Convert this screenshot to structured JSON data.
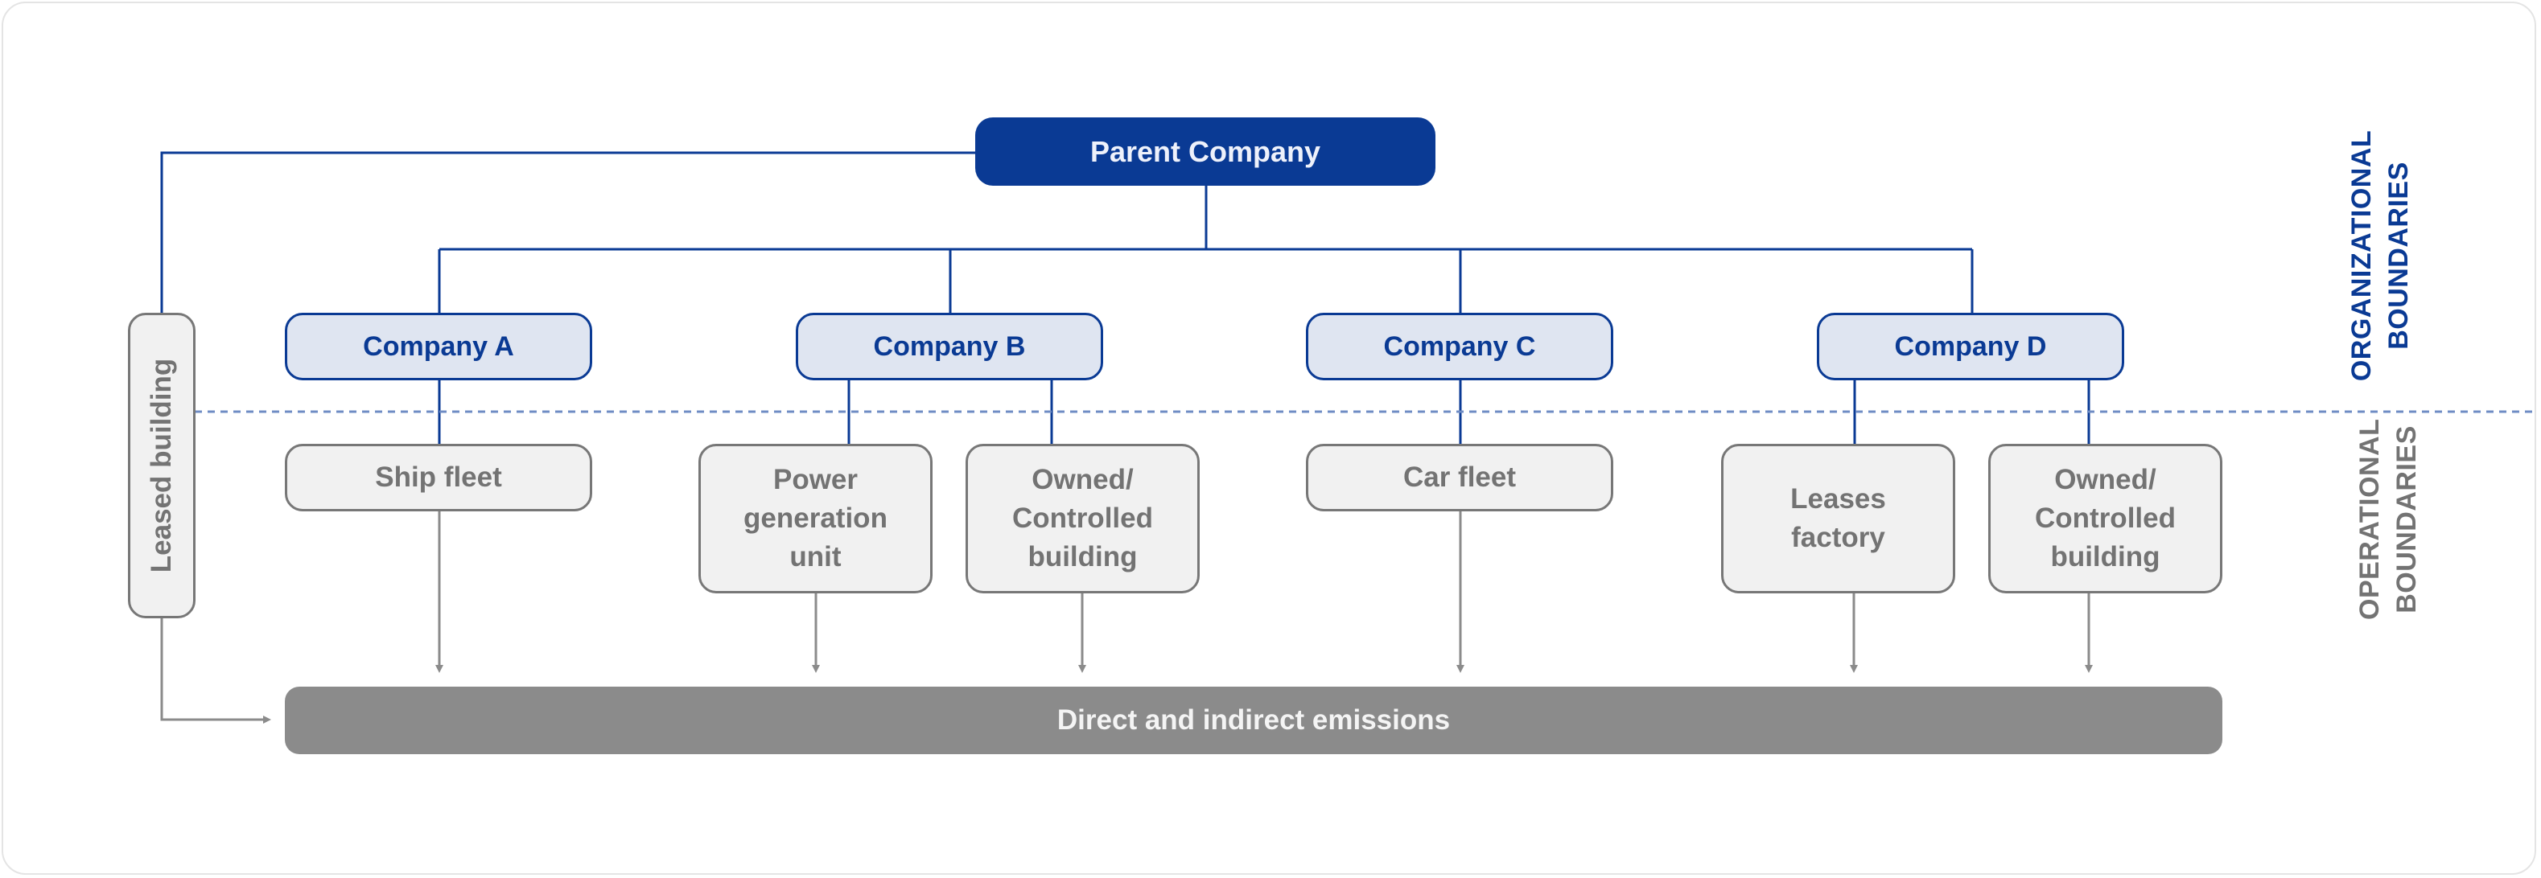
{
  "diagram": {
    "parent": "Parent Company",
    "companies": [
      "Company A",
      "Company B",
      "Company C",
      "Company D"
    ],
    "operations": {
      "ship_fleet": "Ship fleet",
      "power_generation_unit": [
        "Power",
        "generation",
        "unit"
      ],
      "owned_controlled_building_b": [
        "Owned/",
        "Controlled",
        "building"
      ],
      "car_fleet": "Car fleet",
      "leases_factory": [
        "Leases",
        "factory"
      ],
      "owned_controlled_building_d": [
        "Owned/",
        "Controlled",
        "building"
      ]
    },
    "leased_building": "Leased building",
    "emissions": "Direct and indirect emissions",
    "boundaries": {
      "organizational": [
        "ORGANIZATIONAL",
        "BOUNDARIES"
      ],
      "operational": [
        "OPERATIONAL",
        "BOUNDARIES"
      ]
    },
    "colors": {
      "primary_blue": "#0a3a94",
      "company_fill": "#dfe5f1",
      "ops_fill": "#f1f1f1",
      "ops_text": "#737373",
      "emissions_fill": "#8b8b8b",
      "dashed_line": "#6f8cc4"
    }
  }
}
